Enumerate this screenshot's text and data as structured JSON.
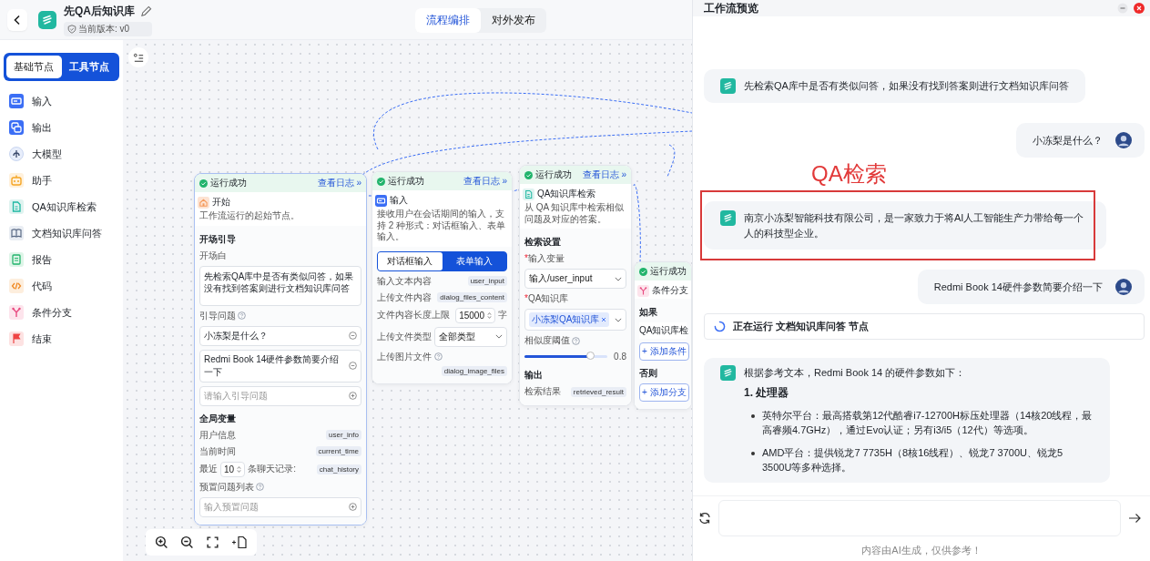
{
  "header": {
    "title": "先QA后知识库",
    "version": "当前版本: v0",
    "tabs": [
      {
        "label": "流程编排",
        "selected": true
      },
      {
        "label": "对外发布",
        "selected": false
      }
    ]
  },
  "sidebar": {
    "tabs": [
      {
        "label": "基础节点",
        "selected": true
      },
      {
        "label": "工具节点",
        "selected": false
      }
    ],
    "items": [
      {
        "label": "输入",
        "kind": "input"
      },
      {
        "label": "输出",
        "kind": "output"
      },
      {
        "label": "大模型",
        "kind": "llm"
      },
      {
        "label": "助手",
        "kind": "assistant"
      },
      {
        "label": "QA知识库检索",
        "kind": "qa"
      },
      {
        "label": "文档知识库问答",
        "kind": "doc"
      },
      {
        "label": "报告",
        "kind": "report"
      },
      {
        "label": "代码",
        "kind": "code"
      },
      {
        "label": "条件分支",
        "kind": "branch"
      },
      {
        "label": "结束",
        "kind": "end"
      }
    ]
  },
  "canvas": {
    "nodes": [
      {
        "kind": "start",
        "status": "运行成功",
        "log": "查看日志 »",
        "title": "开始",
        "description": "工作流运行的起始节点。",
        "rows": [
          {
            "kind": "heading",
            "text": "开场引导"
          },
          {
            "kind": "label",
            "text": "开场白"
          },
          {
            "kind": "textarea",
            "value": "先检索QA库中是否有类似问答，如果没有找到答案则进行文档知识库问答"
          },
          {
            "kind": "label",
            "text": "引导问题",
            "help": true
          },
          {
            "kind": "option",
            "value": "小冻梨是什么？"
          },
          {
            "kind": "option",
            "value": "Redmi Book 14硬件参数简要介绍一下"
          },
          {
            "kind": "add-field",
            "placeholder": "请输入引导问题"
          },
          {
            "kind": "heading",
            "text": "全局变量"
          },
          {
            "kind": "var",
            "label": "用户信息",
            "tag": "user_info"
          },
          {
            "kind": "var",
            "label": "当前时间",
            "tag": "current_time"
          },
          {
            "kind": "recent",
            "label": "最近",
            "value": "10",
            "label2": "条聊天记录:",
            "tag": "chat_history"
          },
          {
            "kind": "label",
            "text": "预置问题列表",
            "help": true
          },
          {
            "kind": "add-field",
            "placeholder": "输入预置问题"
          }
        ]
      },
      {
        "kind": "input",
        "status": "运行成功",
        "log": "查看日志 »",
        "title": "输入",
        "description": "接收用户在会话期间的输入，支持 2 种形式：对话框输入、表单输入。",
        "rows": [
          {
            "kind": "segmented",
            "options": [
              {
                "label": "对话框输入",
                "selected": true
              },
              {
                "label": "表单输入",
                "selected": false
              }
            ]
          },
          {
            "kind": "var",
            "label": "输入文本内容",
            "tag": "user_input"
          },
          {
            "kind": "var",
            "label": "上传文件内容",
            "tag": "dialog_files_content"
          },
          {
            "kind": "number",
            "label": "文件内容长度上限",
            "value": "15000",
            "unit": "字"
          },
          {
            "kind": "select",
            "label": "上传文件类型",
            "value": "全部类型"
          },
          {
            "kind": "var",
            "label": "上传图片文件",
            "tag": "dialog_image_files",
            "help": true
          }
        ]
      },
      {
        "kind": "qa",
        "status": "运行成功",
        "log": "查看日志 »",
        "title": "QA知识库检索",
        "description": "从 QA 知识库中检索相似问题及对应的答案。",
        "rows": [
          {
            "kind": "heading",
            "text": "检索设置"
          },
          {
            "kind": "label",
            "mark": "*",
            "text": "输入变量"
          },
          {
            "kind": "select",
            "value": "输入/user_input"
          },
          {
            "kind": "label",
            "mark": "*",
            "text": "QA知识库"
          },
          {
            "kind": "chips",
            "chips": [
              "小冻梨QA知识库"
            ]
          },
          {
            "kind": "label",
            "text": "相似度阈值",
            "help": true
          },
          {
            "kind": "slider",
            "level": 0.8,
            "reading": "0.8"
          },
          {
            "kind": "heading",
            "text": "输出"
          },
          {
            "kind": "var",
            "label": "检索结果",
            "tag": "retrieved_result"
          }
        ]
      },
      {
        "kind": "branch",
        "status": "运行成功",
        "title": "条件分支",
        "rows": [
          {
            "kind": "heading",
            "text": "如果"
          },
          {
            "kind": "case",
            "value": "QA知识库检"
          },
          {
            "kind": "add-button",
            "text": "+ 添加条件"
          },
          {
            "kind": "heading",
            "text": "否则"
          },
          {
            "kind": "add-button",
            "text": "+ 添加分支"
          }
        ]
      }
    ]
  },
  "preview": {
    "title": "工作流预览",
    "messages": [
      {
        "kind": "bot",
        "text": "先检索QA库中是否有类似问答，如果没有找到答案则进行文档知识库问答",
        "highlighted": false
      },
      {
        "kind": "user",
        "text": "小冻梨是什么？"
      },
      {
        "kind": "bot",
        "text": "南京小冻梨智能科技有限公司，是一家致力于将AI人工智能生产力带给每一个人的科技型企业。",
        "highlighted": true,
        "annotation": "QA检索"
      },
      {
        "kind": "user",
        "text": "Redmi Book 14硬件参数简要介绍一下"
      },
      {
        "kind": "status",
        "text": "正在运行 文档知识库问答 节点"
      },
      {
        "kind": "answer",
        "intro": "根据参考文本，Redmi Book 14 的硬件参数如下：",
        "heading": "1. 处理器",
        "bullets": [
          "英特尔平台：最高搭载第12代酷睿i7-12700H标压处理器（14核20线程，最高睿频4.7GHz），通过Evo认证；另有i3/i5（12代）等选项。",
          "AMD平台：提供锐龙7 7735H（8核16线程）、锐龙7 3700U、锐龙5 3500U等多种选择。"
        ]
      }
    ],
    "footer": "内容由AI生成，仅供参考！"
  }
}
